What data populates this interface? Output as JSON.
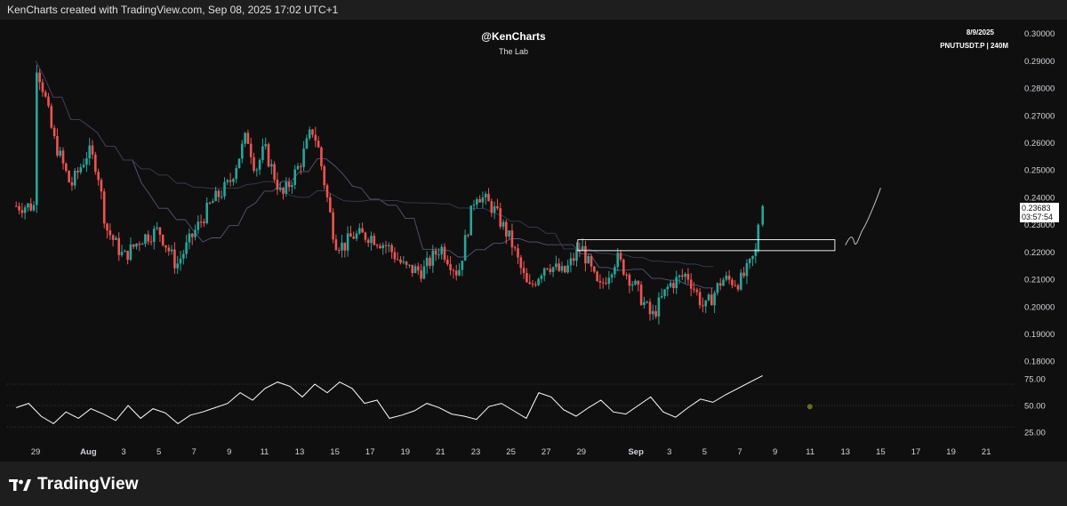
{
  "header": {
    "caption": "KenCharts created with TradingView.com, Sep 08, 2025 17:02 UTC+1"
  },
  "overlay": {
    "author": "@KenCharts",
    "subtitle": "The Lab",
    "date": "8/9/2025",
    "symbol": "PNUTUSDT.P | 240M"
  },
  "price_tag": {
    "price": "0.23683",
    "countdown": "03:57:54"
  },
  "footer": {
    "brand": "TradingView"
  },
  "colors": {
    "up": "#26a69a",
    "down": "#ef5350",
    "background": "#0f0f0f",
    "rsi_line": "#ffffff",
    "ma_line": "#4a4a68"
  },
  "chart_data": [
    {
      "type": "candlestick",
      "symbol": "PNUTUSDT.P",
      "timeframe": "240M",
      "y_ticks": [
        "0.30000",
        "0.29000",
        "0.28000",
        "0.27000",
        "0.26000",
        "0.25000",
        "0.24000",
        "0.23000",
        "0.22000",
        "0.21000",
        "0.20000",
        "0.19000",
        "0.18000"
      ],
      "ylim": [
        0.1765,
        0.302
      ],
      "x_ticks": [
        "29",
        "Aug",
        "3",
        "5",
        "7",
        "9",
        "11",
        "13",
        "15",
        "17",
        "19",
        "21",
        "23",
        "25",
        "27",
        "29",
        "Sep",
        "3",
        "5",
        "7",
        "9",
        "11",
        "13",
        "15",
        "17",
        "19",
        "21"
      ],
      "close_path": [
        [
          "29",
          0.29
        ],
        [
          "29.5",
          0.278
        ],
        [
          "30",
          0.262
        ],
        [
          "31",
          0.244
        ],
        [
          "Aug 1",
          0.257
        ],
        [
          "Aug 1.5",
          0.251
        ],
        [
          "2",
          0.229
        ],
        [
          "3",
          0.218
        ],
        [
          "4",
          0.225
        ],
        [
          "5",
          0.228
        ],
        [
          "6",
          0.215
        ],
        [
          "7",
          0.227
        ],
        [
          "8",
          0.238
        ],
        [
          "9",
          0.245
        ],
        [
          "10",
          0.263
        ],
        [
          "10.5",
          0.25
        ],
        [
          "11",
          0.258
        ],
        [
          "12",
          0.24
        ],
        [
          "13",
          0.252
        ],
        [
          "13.7",
          0.265
        ],
        [
          "14",
          0.26
        ],
        [
          "15",
          0.224
        ],
        [
          "15.5",
          0.222
        ],
        [
          "16",
          0.226
        ],
        [
          "17",
          0.226
        ],
        [
          "18",
          0.222
        ],
        [
          "19",
          0.214
        ],
        [
          "20",
          0.213
        ],
        [
          "21",
          0.222
        ],
        [
          "22",
          0.212
        ],
        [
          "23",
          0.242
        ],
        [
          "24",
          0.236
        ],
        [
          "25",
          0.224
        ],
        [
          "26",
          0.206
        ],
        [
          "27",
          0.216
        ],
        [
          "28",
          0.212
        ],
        [
          "29",
          0.222
        ],
        [
          "30",
          0.206
        ],
        [
          "31",
          0.218
        ],
        [
          "Sep 1",
          0.208
        ],
        [
          "2",
          0.196
        ],
        [
          "3",
          0.208
        ],
        [
          "4",
          0.212
        ],
        [
          "5",
          0.199
        ],
        [
          "6",
          0.21
        ],
        [
          "7",
          0.209
        ],
        [
          "7.5",
          0.214
        ],
        [
          "8",
          0.2215
        ],
        [
          "8.3",
          0.23683
        ]
      ],
      "resistance_box": {
        "from": "Aug 29",
        "to": "Sep 12",
        "low": 0.2205,
        "high": 0.2245
      },
      "projection": {
        "from": "Sep 13",
        "to": "Sep 15",
        "low": 0.2225,
        "high": 0.2435
      }
    },
    {
      "type": "line",
      "name": "RSI",
      "y_ticks": [
        "75.00",
        "50.00",
        "25.00"
      ],
      "ylim": [
        20,
        80
      ],
      "levels": [
        70,
        50,
        30
      ],
      "values": [
        48,
        52,
        40,
        33,
        44,
        38,
        47,
        42,
        36,
        50,
        38,
        47,
        43,
        33,
        41,
        44,
        48,
        52,
        62,
        55,
        66,
        72,
        68,
        58,
        70,
        62,
        72,
        66,
        52,
        55,
        38,
        41,
        45,
        52,
        48,
        42,
        40,
        37,
        49,
        52,
        45,
        38,
        62,
        58,
        46,
        40,
        48,
        55,
        44,
        42,
        50,
        58,
        44,
        39,
        48,
        56,
        53,
        60,
        66,
        72,
        78
      ],
      "marker_value": 49
    }
  ]
}
